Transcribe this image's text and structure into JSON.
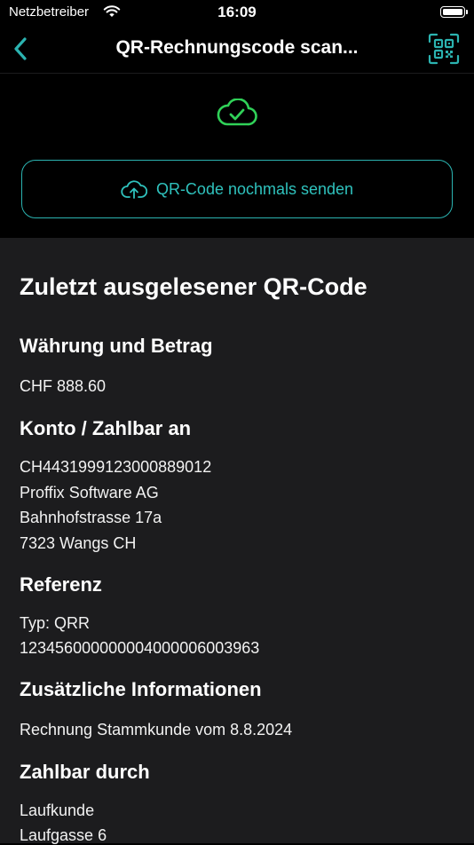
{
  "status_bar": {
    "carrier": "Netzbetreiber",
    "time": "16:09"
  },
  "nav": {
    "title": "QR-Rechnungscode scan...",
    "back_icon": "chevron-left-icon",
    "qr_icon": "qr-code-icon"
  },
  "colors": {
    "accent": "#2bb3b0",
    "success": "#30d158",
    "content_bg": "#1c1c1e"
  },
  "resend": {
    "label": "QR-Code nochmals senden",
    "icon": "cloud-upload-icon"
  },
  "last_scan": {
    "heading": "Zuletzt ausgelesener QR-Code",
    "currency_amount": {
      "title": "Währung und Betrag",
      "value": "CHF 888.60"
    },
    "account": {
      "title": "Konto / Zahlbar an",
      "iban": "CH4431999123000889012",
      "name": "Proffix Software AG",
      "street": "Bahnhofstrasse 17a",
      "city": "7323 Wangs CH"
    },
    "reference": {
      "title": "Referenz",
      "type": "Typ: QRR",
      "number": "123456000000004000006003963"
    },
    "additional": {
      "title": "Zusätzliche Informationen",
      "value": "Rechnung Stammkunde vom 8.8.2024"
    },
    "payable_by": {
      "title": "Zahlbar durch",
      "name": "Laufkunde",
      "street": "Laufgasse 6"
    }
  }
}
